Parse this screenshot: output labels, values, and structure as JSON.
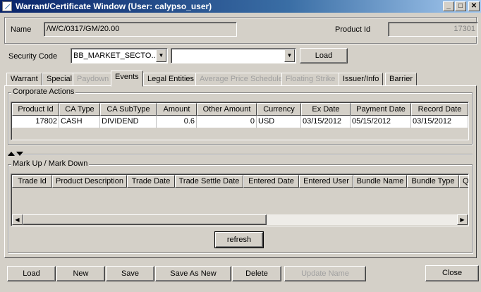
{
  "window": {
    "title": "Warrant/Certificate Window (User: calypso_user)",
    "min": "_",
    "max": "□",
    "close": "✕"
  },
  "name_label": "Name",
  "name_value": "/W/C/0317/GM/20.00",
  "product_id_label": "Product Id",
  "product_id_value": "17301",
  "security_code_label": "Security Code",
  "security_code_value": "BB_MARKET_SECTO...",
  "security_code_input": "",
  "load_top": "Load",
  "tabs": [
    "Warrant",
    "Special",
    "Paydown",
    "Events",
    "Legal Entities",
    "Average Price Schedule",
    "Floating Strike",
    "Issuer/Info",
    "Barrier"
  ],
  "corporate_actions": {
    "title": "Corporate Actions",
    "columns": [
      "Product Id",
      "CA Type",
      "CA SubType",
      "Amount",
      "Other Amount",
      "Currency",
      "Ex Date",
      "Payment Date",
      "Record Date"
    ],
    "row": [
      "17802",
      "CASH",
      "DIVIDEND",
      "0.6",
      "0",
      "USD",
      "03/15/2012",
      "05/15/2012",
      "03/15/2012"
    ]
  },
  "markup": {
    "title": "Mark Up / Mark Down",
    "columns": [
      "Trade Id",
      "Product Description",
      "Trade Date",
      "Trade Settle Date",
      "Entered Date",
      "Entered User",
      "Bundle Name",
      "Bundle Type",
      "Q"
    ],
    "refresh": "refresh"
  },
  "bottom": {
    "load": "Load",
    "new": "New",
    "save": "Save",
    "save_as_new": "Save As New",
    "delete": "Delete",
    "update_name": "Update Name",
    "close": "Close"
  }
}
